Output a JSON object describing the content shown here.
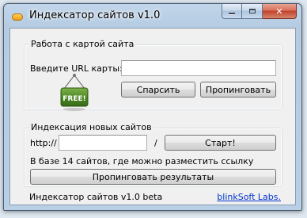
{
  "window": {
    "title": "Индексатор сайтов v1.0",
    "icon": "app-pill-icon"
  },
  "map_group": {
    "title": "Работа с картой сайта",
    "url_label": "Введите URL карты:",
    "url_value": "",
    "parse_label": "Спарсить",
    "ping_label": "Пропинговать",
    "badge_text": "FREE!"
  },
  "index_group": {
    "title": "Индексация новых сайтов",
    "prefix_label": "http://",
    "site_value": "",
    "slash_label": "/",
    "start_label": "Старт!",
    "info_text": "В базе 14 сайтов, где можно разместить ссылку",
    "ping_results_label": "Пропинговать результаты"
  },
  "status": {
    "version_text": "Индексатор сайтов v1.0 beta",
    "company_link": "blinkSoft Labs."
  }
}
